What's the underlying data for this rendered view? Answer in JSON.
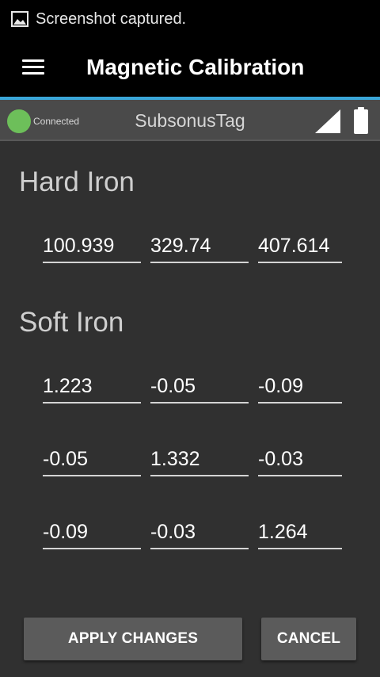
{
  "status_bar": {
    "notification_icon": "image-icon",
    "text": "Screenshot captured."
  },
  "app_bar": {
    "menu_icon": "hamburger-menu-icon",
    "title": "Magnetic Calibration"
  },
  "device_bar": {
    "connection_status": "Connected",
    "device_name": "SubsonusTag",
    "status_color": "#6dbf5a"
  },
  "hard_iron": {
    "title": "Hard Iron",
    "values": [
      "100.939",
      "329.74",
      "407.614"
    ]
  },
  "soft_iron": {
    "title": "Soft Iron",
    "rows": [
      [
        "1.223",
        "-0.05",
        "-0.09"
      ],
      [
        "-0.05",
        "1.332",
        "-0.03"
      ],
      [
        "-0.09",
        "-0.03",
        "1.264"
      ]
    ]
  },
  "actions": {
    "apply_label": "APPLY CHANGES",
    "cancel_label": "CANCEL"
  },
  "colors": {
    "accent": "#3aa6d8",
    "background": "#303030",
    "button": "#5b5b5b"
  }
}
